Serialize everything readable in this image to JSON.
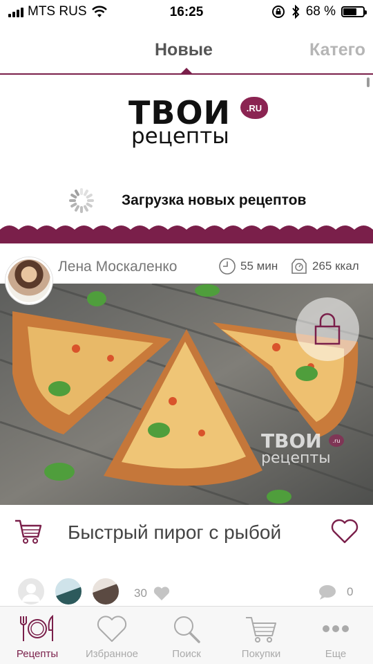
{
  "status_bar": {
    "carrier": "MTS RUS",
    "time": "16:25",
    "battery": "68 %",
    "battery_level": 0.68
  },
  "top_tabs": {
    "active": "Новые",
    "next": "Катего"
  },
  "logo": {
    "main": "ТВОИ",
    "sub": "рецепты",
    "badge": ".RU"
  },
  "loading": {
    "text": "Загрузка новых рецептов"
  },
  "recipe": {
    "author": "Лена Москаленко",
    "time": "55 мин",
    "calories": "265 ккал",
    "title": "Быстрый пирог с рыбой",
    "watermark_main": "ТВОИ",
    "watermark_sub": "рецепты",
    "watermark_badge": ".ru",
    "likes": "30",
    "comments": "0"
  },
  "bottom_nav": {
    "items": [
      {
        "label": "Рецепты",
        "icon": "plate-cutlery-icon"
      },
      {
        "label": "Избранное",
        "icon": "heart-icon"
      },
      {
        "label": "Поиск",
        "icon": "search-icon"
      },
      {
        "label": "Покупки",
        "icon": "cart-icon"
      },
      {
        "label": "Еще",
        "icon": "more-dots-icon"
      }
    ]
  },
  "colors": {
    "accent": "#7a1f4a",
    "muted": "#aaaaaa"
  }
}
